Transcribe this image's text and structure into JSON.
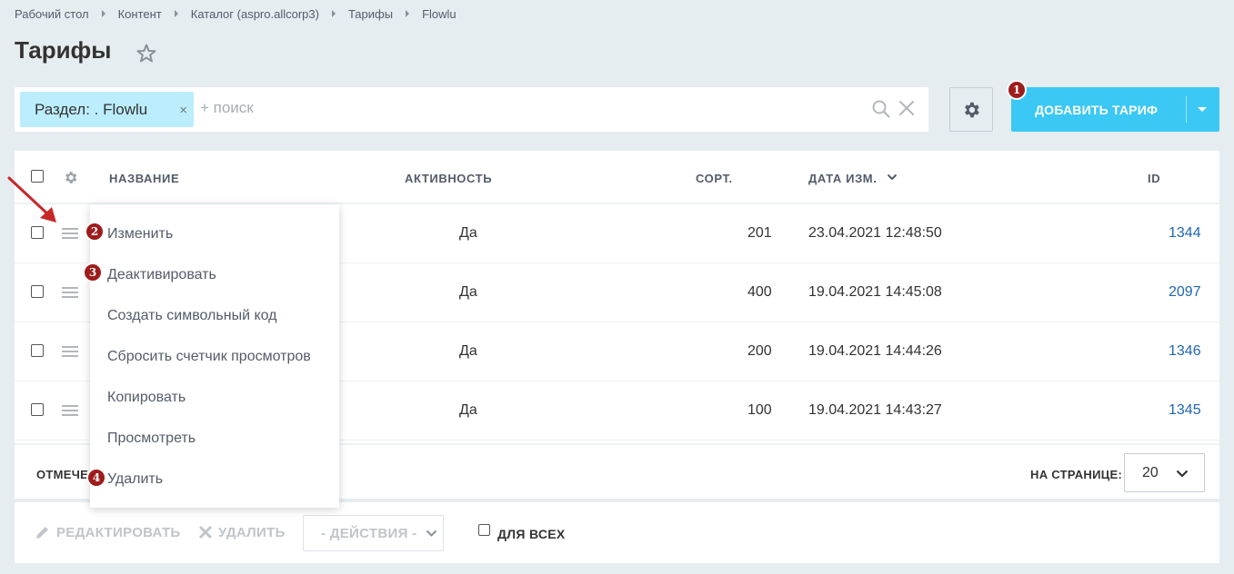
{
  "breadcrumb": [
    "Рабочий стол",
    "Контент",
    "Каталог (aspro.allcorp3)",
    "Тарифы",
    "Flowlu"
  ],
  "page_title": "Тарифы",
  "filter": {
    "tag": "Раздел: . Flowlu",
    "tag_close": "×",
    "placeholder": "+ поиск"
  },
  "add_button": {
    "label": "ДОБАВИТЬ ТАРИФ"
  },
  "badges": {
    "b1": "1",
    "b2": "2",
    "b3": "3",
    "b4": "4"
  },
  "columns": {
    "name": "НАЗВАНИЕ",
    "active": "АКТИВНОСТЬ",
    "sort": "СОРТ.",
    "date": "ДАТА ИЗМ.",
    "id": "ID"
  },
  "rows": [
    {
      "active": "Да",
      "sort": "201",
      "date": "23.04.2021 12:48:50",
      "id": "1344"
    },
    {
      "active": "Да",
      "sort": "400",
      "date": "19.04.2021 14:45:08",
      "id": "2097"
    },
    {
      "active": "Да",
      "sort": "200",
      "date": "19.04.2021 14:44:26",
      "id": "1346"
    },
    {
      "active": "Да",
      "sort": "100",
      "date": "19.04.2021 14:43:27",
      "id": "1345"
    }
  ],
  "context_menu": [
    "Изменить",
    "Деактивировать",
    "Создать символьный код",
    "Сбросить счетчик просмотров",
    "Копировать",
    "Просмотреть",
    "Удалить"
  ],
  "footer": {
    "marked_label": "ОТМЕЧЕН",
    "per_page_label": "НА СТРАНИЦЕ:",
    "per_page_value": "20"
  },
  "actions": {
    "edit": "РЕДАКТИРОВАТЬ",
    "delete": "УДАЛИТЬ",
    "select": "- ДЕЙСТВИЯ -",
    "for_all": "ДЛЯ ВСЕХ"
  },
  "colors": {
    "accent": "#3bc8f5",
    "badge": "#9e1c1c",
    "arrow": "#c62828",
    "link": "#2067b0"
  }
}
